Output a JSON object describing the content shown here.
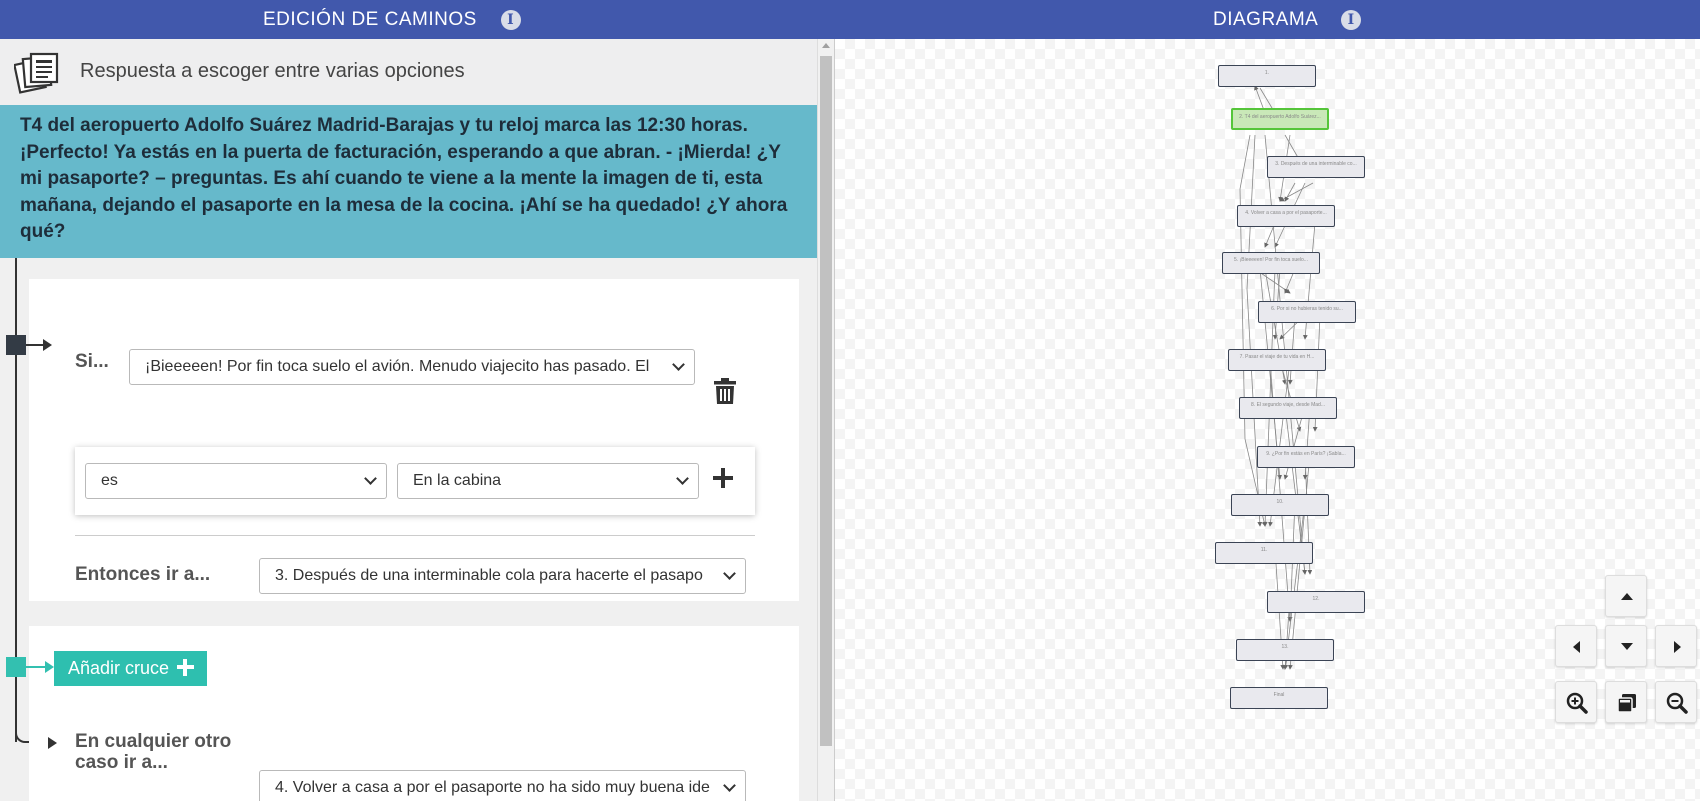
{
  "header": {
    "left_title": "EDICIÓN DE CAMINOS",
    "right_title": "DIAGRAMA",
    "info_glyph": "i"
  },
  "question": {
    "type_label": "Respuesta a escoger entre varias opciones",
    "text": "T4 del aeropuerto Adolfo Suárez Madrid-Barajas y tu reloj marca las 12:30 horas. ¡Perfecto! Ya estás en la puerta de facturación, esperando a que abran. - ¡Mierda! ¿Y mi pasaporte? – preguntas. Es ahí cuando te viene a la mente la imagen de ti, esta mañana, dejando el pasaporte en la mesa de la cocina. ¡Ahí se ha quedado! ¿Y ahora qué?"
  },
  "rule": {
    "if_label": "Si...",
    "if_select": "¡Bieeeeen! Por fin toca suelo el avión. Menudo viajecito has pasado. El",
    "operator_select": "es",
    "value_select": "En la cabina",
    "then_label": "Entonces ir a...",
    "then_select": "3. Después de una interminable cola para hacerte el pasapo"
  },
  "add_cross_label": "Añadir cruce",
  "else": {
    "label": "En cualquier otro caso ir a...",
    "select": "4. Volver a casa a por el pasaporte no ha sido muy buena ide"
  },
  "diagram": {
    "nodes": [
      {
        "label": "1."
      },
      {
        "label": "2. T4 del aeropuerto Adolfo Suárez..."
      },
      {
        "label": "3. Después de una interminable co..."
      },
      {
        "label": "4. Volver a casa a por el pasaporte..."
      },
      {
        "label": "5. ¡Bieeeeen! Por fin toca suelo..."
      },
      {
        "label": "6. Por si no hubieras tenido su..."
      },
      {
        "label": "7. Pasar el viaje de tu vida en H..."
      },
      {
        "label": "8. El segundo viaje, desde Mad..."
      },
      {
        "label": "9. ¿Por fin estás en París? ¡Sabía..."
      },
      {
        "label": "10."
      },
      {
        "label": "11."
      },
      {
        "label": "12."
      },
      {
        "label": "13."
      },
      {
        "label": "Final"
      }
    ]
  },
  "icons": {
    "info": "info-icon",
    "question_type": "cards-stack-icon",
    "delete": "trash-icon",
    "add_condition": "plus-icon",
    "chevron": "chevron-down-icon",
    "zoom_in": "zoom-in-icon",
    "fit": "fit-view-icon",
    "zoom_out": "zoom-out-icon"
  },
  "colors": {
    "header_bg": "#4158ac",
    "question_bg": "#66b9cb",
    "add_button_bg": "#2ebfaf",
    "active_node": "#55c53a"
  }
}
